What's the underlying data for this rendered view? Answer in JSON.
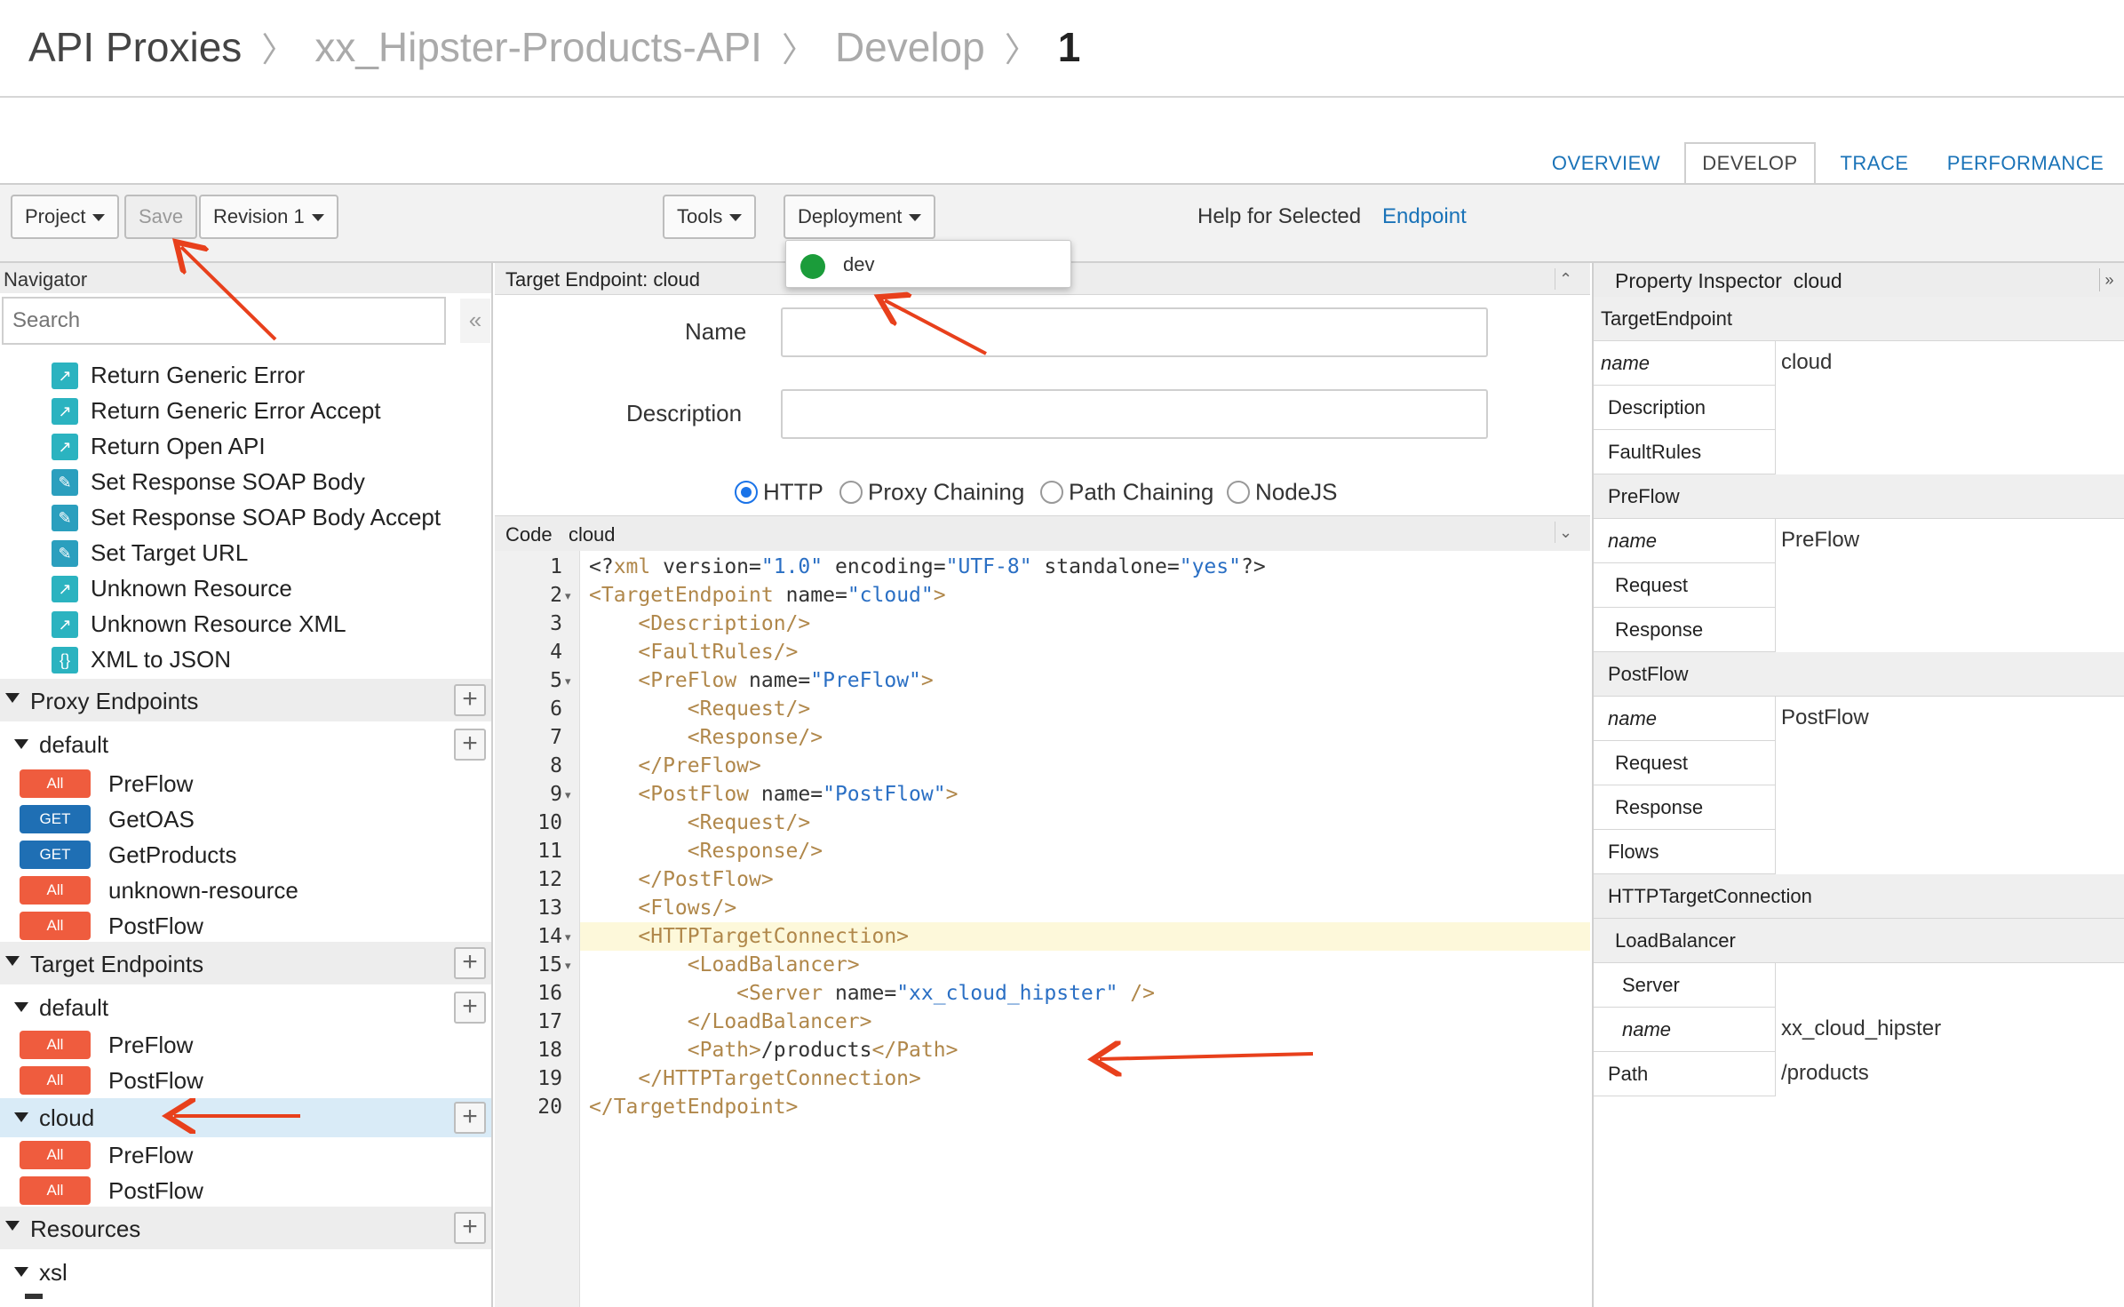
{
  "breadcrumb": {
    "items": [
      "API Proxies",
      "xx_Hipster-Products-API",
      "Develop",
      "1"
    ]
  },
  "tabs": [
    "OVERVIEW",
    "DEVELOP",
    "TRACE",
    "PERFORMANCE"
  ],
  "toolbar": {
    "project": "Project",
    "save": "Save",
    "revision": "Revision 1",
    "tools": "Tools",
    "deployment": "Deployment",
    "help_text": "Help for Selected",
    "help_link": "Endpoint"
  },
  "deployment_menu": {
    "env": "dev"
  },
  "navigator": {
    "title": "Navigator",
    "search_placeholder": "Search",
    "collapse": "«",
    "policies": [
      "Return Generic Error",
      "Return Generic Error Accept",
      "Return Open API",
      "Set Response SOAP Body",
      "Set Response SOAP Body Accept",
      "Set Target URL",
      "Unknown Resource",
      "Unknown Resource XML",
      "XML to JSON"
    ],
    "proxy_endpoints": {
      "label": "Proxy Endpoints",
      "default": "default",
      "flows": [
        {
          "verb": "All",
          "name": "PreFlow"
        },
        {
          "verb": "GET",
          "name": "GetOAS"
        },
        {
          "verb": "GET",
          "name": "GetProducts"
        },
        {
          "verb": "All",
          "name": "unknown-resource"
        },
        {
          "verb": "All",
          "name": "PostFlow"
        }
      ]
    },
    "target_endpoints": {
      "label": "Target Endpoints",
      "default": "default",
      "default_flows": [
        {
          "verb": "All",
          "name": "PreFlow"
        },
        {
          "verb": "All",
          "name": "PostFlow"
        }
      ],
      "cloud": "cloud",
      "cloud_flows": [
        {
          "verb": "All",
          "name": "PreFlow"
        },
        {
          "verb": "All",
          "name": "PostFlow"
        }
      ]
    },
    "resources": {
      "label": "Resources",
      "xsl": "xsl"
    }
  },
  "target_panel": {
    "title": "Target Endpoint: cloud",
    "name_label": "Name",
    "description_label": "Description",
    "radios": [
      "HTTP",
      "Proxy Chaining",
      "Path Chaining",
      "NodeJS"
    ],
    "selected_radio": "HTTP"
  },
  "code_panel": {
    "title": "Code",
    "name": "cloud",
    "active_line": 14
  },
  "inspector": {
    "title": "Property Inspector",
    "name": "cloud",
    "rows": [
      {
        "key": "TargetEndpoint",
        "group": true,
        "indent": 0
      },
      {
        "key": "name",
        "value": "cloud",
        "italic": true,
        "indent": 0
      },
      {
        "key": "Description",
        "value": "",
        "indent": 1
      },
      {
        "key": "FaultRules",
        "value": "",
        "indent": 1
      },
      {
        "key": "PreFlow",
        "group": true,
        "indent": 1
      },
      {
        "key": "name",
        "value": "PreFlow",
        "italic": true,
        "indent": 1
      },
      {
        "key": "Request",
        "value": "",
        "indent": 2
      },
      {
        "key": "Response",
        "value": "",
        "indent": 2
      },
      {
        "key": "PostFlow",
        "group": true,
        "indent": 1
      },
      {
        "key": "name",
        "value": "PostFlow",
        "italic": true,
        "indent": 1
      },
      {
        "key": "Request",
        "value": "",
        "indent": 2
      },
      {
        "key": "Response",
        "value": "",
        "indent": 2
      },
      {
        "key": "Flows",
        "value": "",
        "indent": 1
      },
      {
        "key": "HTTPTargetConnection",
        "group": true,
        "indent": 1
      },
      {
        "key": "LoadBalancer",
        "group": true,
        "indent": 2
      },
      {
        "key": "Server",
        "value": "",
        "indent": 3
      },
      {
        "key": "name",
        "value": "xx_cloud_hipster",
        "italic": true,
        "indent": 3
      },
      {
        "key": "Path",
        "value": "/products",
        "indent": 1
      }
    ]
  },
  "code_lines": [
    {
      "n": "1",
      "fold": false,
      "tokens": [
        [
          "d",
          "<?"
        ],
        [
          "t",
          "xml"
        ],
        [
          "a",
          " version="
        ],
        [
          "v",
          "\"1.0\""
        ],
        [
          "a",
          " encoding="
        ],
        [
          "v",
          "\"UTF-8\""
        ],
        [
          "a",
          " standalone="
        ],
        [
          "v",
          "\"yes\""
        ],
        [
          "d",
          "?>"
        ]
      ]
    },
    {
      "n": "2",
      "fold": true,
      "tokens": [
        [
          "t",
          "<TargetEndpoint"
        ],
        [
          "a",
          " name="
        ],
        [
          "v",
          "\"cloud\""
        ],
        [
          "t",
          ">"
        ]
      ]
    },
    {
      "n": "3",
      "fold": false,
      "tokens": [
        [
          "d",
          "    "
        ],
        [
          "t",
          "<Description/>"
        ]
      ]
    },
    {
      "n": "4",
      "fold": false,
      "tokens": [
        [
          "d",
          "    "
        ],
        [
          "t",
          "<FaultRules/>"
        ]
      ]
    },
    {
      "n": "5",
      "fold": true,
      "tokens": [
        [
          "d",
          "    "
        ],
        [
          "t",
          "<PreFlow"
        ],
        [
          "a",
          " name="
        ],
        [
          "v",
          "\"PreFlow\""
        ],
        [
          "t",
          ">"
        ]
      ]
    },
    {
      "n": "6",
      "fold": false,
      "tokens": [
        [
          "d",
          "        "
        ],
        [
          "t",
          "<Request/>"
        ]
      ]
    },
    {
      "n": "7",
      "fold": false,
      "tokens": [
        [
          "d",
          "        "
        ],
        [
          "t",
          "<Response/>"
        ]
      ]
    },
    {
      "n": "8",
      "fold": false,
      "tokens": [
        [
          "d",
          "    "
        ],
        [
          "t",
          "</PreFlow>"
        ]
      ]
    },
    {
      "n": "9",
      "fold": true,
      "tokens": [
        [
          "d",
          "    "
        ],
        [
          "t",
          "<PostFlow"
        ],
        [
          "a",
          " name="
        ],
        [
          "v",
          "\"PostFlow\""
        ],
        [
          "t",
          ">"
        ]
      ]
    },
    {
      "n": "10",
      "fold": false,
      "tokens": [
        [
          "d",
          "        "
        ],
        [
          "t",
          "<Request/>"
        ]
      ]
    },
    {
      "n": "11",
      "fold": false,
      "tokens": [
        [
          "d",
          "        "
        ],
        [
          "t",
          "<Response/>"
        ]
      ]
    },
    {
      "n": "12",
      "fold": false,
      "tokens": [
        [
          "d",
          "    "
        ],
        [
          "t",
          "</PostFlow>"
        ]
      ]
    },
    {
      "n": "13",
      "fold": false,
      "tokens": [
        [
          "d",
          "    "
        ],
        [
          "t",
          "<Flows/>"
        ]
      ]
    },
    {
      "n": "14",
      "fold": true,
      "tokens": [
        [
          "d",
          "    "
        ],
        [
          "t",
          "<HTTPTargetConnection>"
        ]
      ]
    },
    {
      "n": "15",
      "fold": true,
      "tokens": [
        [
          "d",
          "        "
        ],
        [
          "t",
          "<LoadBalancer>"
        ]
      ]
    },
    {
      "n": "16",
      "fold": false,
      "tokens": [
        [
          "d",
          "            "
        ],
        [
          "t",
          "<Server"
        ],
        [
          "a",
          " name="
        ],
        [
          "v",
          "\"xx_cloud_hipster\""
        ],
        [
          "t",
          " />"
        ]
      ]
    },
    {
      "n": "17",
      "fold": false,
      "tokens": [
        [
          "d",
          "        "
        ],
        [
          "t",
          "</LoadBalancer>"
        ]
      ]
    },
    {
      "n": "18",
      "fold": false,
      "tokens": [
        [
          "d",
          "        "
        ],
        [
          "t",
          "<Path>"
        ],
        [
          "d",
          "/products"
        ],
        [
          "t",
          "</Path>"
        ]
      ]
    },
    {
      "n": "19",
      "fold": false,
      "tokens": [
        [
          "d",
          "    "
        ],
        [
          "t",
          "</HTTPTargetConnection>"
        ]
      ]
    },
    {
      "n": "20",
      "fold": false,
      "tokens": [
        [
          "t",
          "</TargetEndpoint>"
        ]
      ]
    }
  ],
  "colors": {
    "link": "#1a73b8",
    "verb_all": "#ef5c3e",
    "verb_get": "#1f6fb4",
    "tag": "#b0874a",
    "attr_value": "#2a6fc4",
    "annotation_arrow": "#e8401c",
    "deploy_status": "#1b9c3a"
  }
}
